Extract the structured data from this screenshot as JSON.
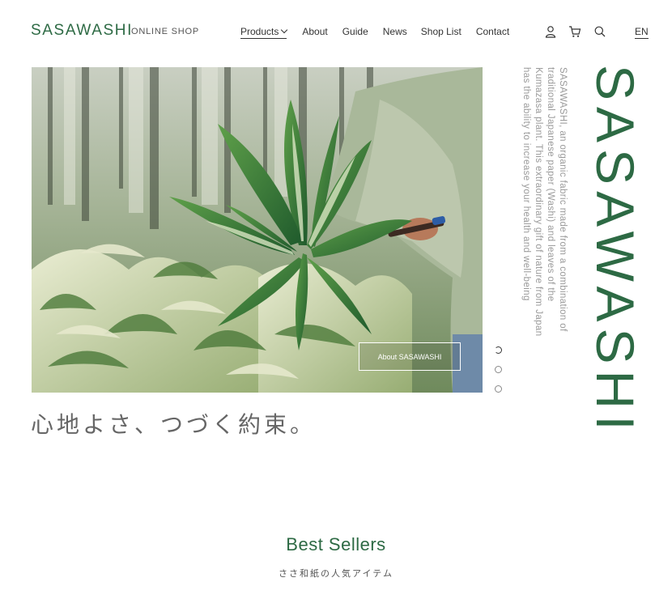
{
  "header": {
    "logo": "SASAWASHI",
    "logo_sub": "ONLINE SHOP",
    "nav": [
      "Products",
      "About",
      "Guide",
      "News",
      "Shop List",
      "Contact"
    ],
    "icons": [
      "user-icon",
      "cart-icon",
      "search-icon"
    ],
    "lang": "EN"
  },
  "hero": {
    "button_label": "About SASAWASHI",
    "slides": 3,
    "active_slide": 1
  },
  "side": {
    "vertical_title": "SASAWASHI",
    "description_lines": [
      "SASAWASHI, an organic fabric made from a combination of",
      "traditional Japanese paper (Washi) and leaves of the",
      "Kumazasa plant. This extraordinary gift of nature from Japan",
      "has the ability to increase your health and well-being"
    ]
  },
  "tagline": "心地よさ、つづく約束。",
  "best_sellers": {
    "title": "Best Sellers",
    "subtitle": "ささ和紙の人気アイテム"
  },
  "colors": {
    "brand": "#2d6a44",
    "muted": "#9a9a9a"
  }
}
